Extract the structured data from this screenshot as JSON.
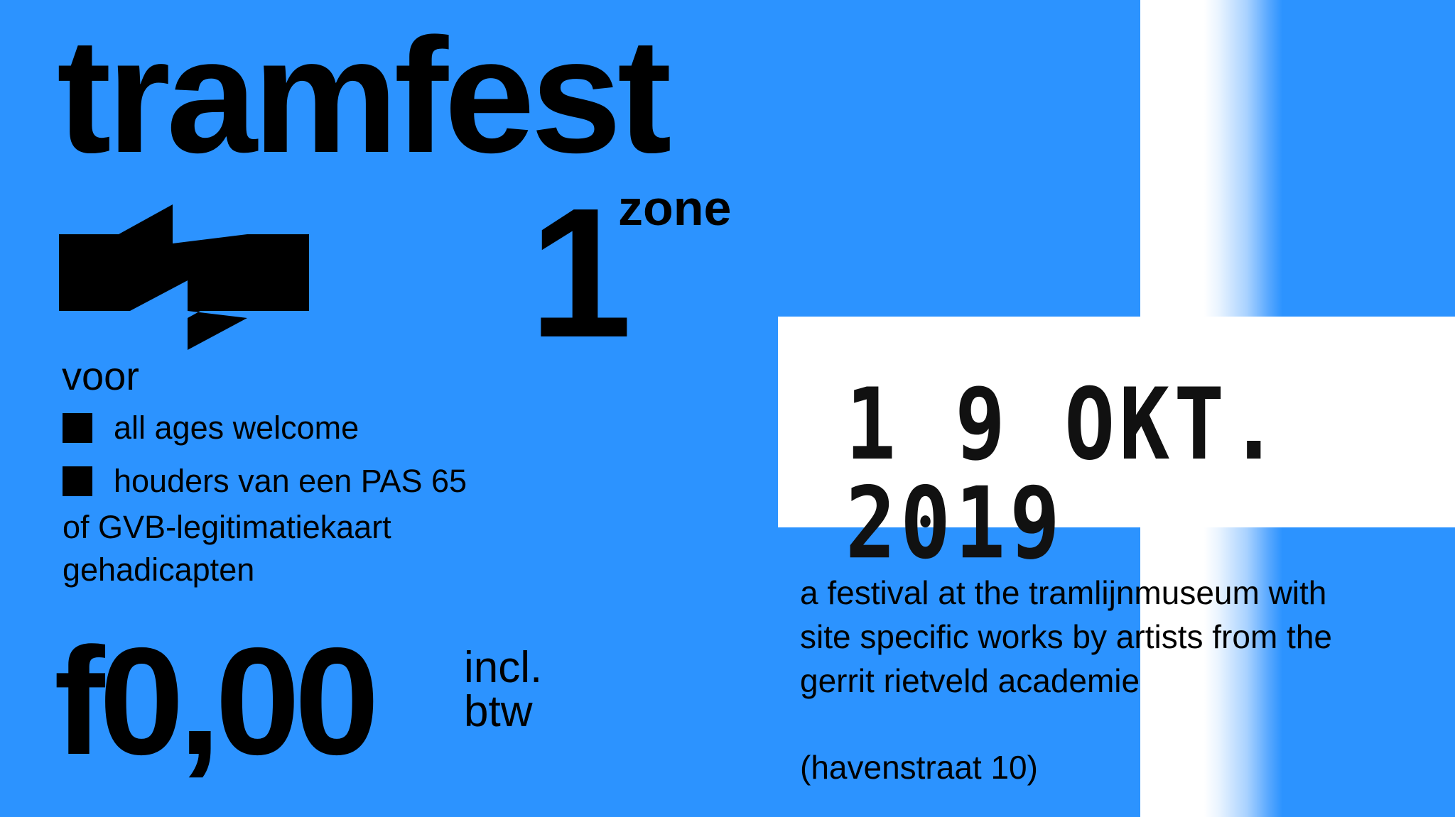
{
  "ticket": {
    "title": "tramfest",
    "zone_number": "1",
    "zone_label": "zone",
    "logo_icon": "gvb-logo-icon",
    "voor": "voor",
    "bullets": [
      "all ages welcome",
      "houders van een PAS 65"
    ],
    "extra_lines": [
      "of GVB-legitimatiekaart",
      "gehadicapten"
    ],
    "price": "f0,00",
    "vat_lines": [
      "incl.",
      "btw"
    ],
    "stamp_date": "1 9 OKT. 2019",
    "description": [
      "a festival at the tramlijnmuseum with",
      "site specific works by artists from the",
      "gerrit rietveld academie"
    ],
    "address": "(havenstraat 10)"
  },
  "colors": {
    "background": "#2c93ff",
    "band": "#ffffff",
    "text": "#000000"
  }
}
